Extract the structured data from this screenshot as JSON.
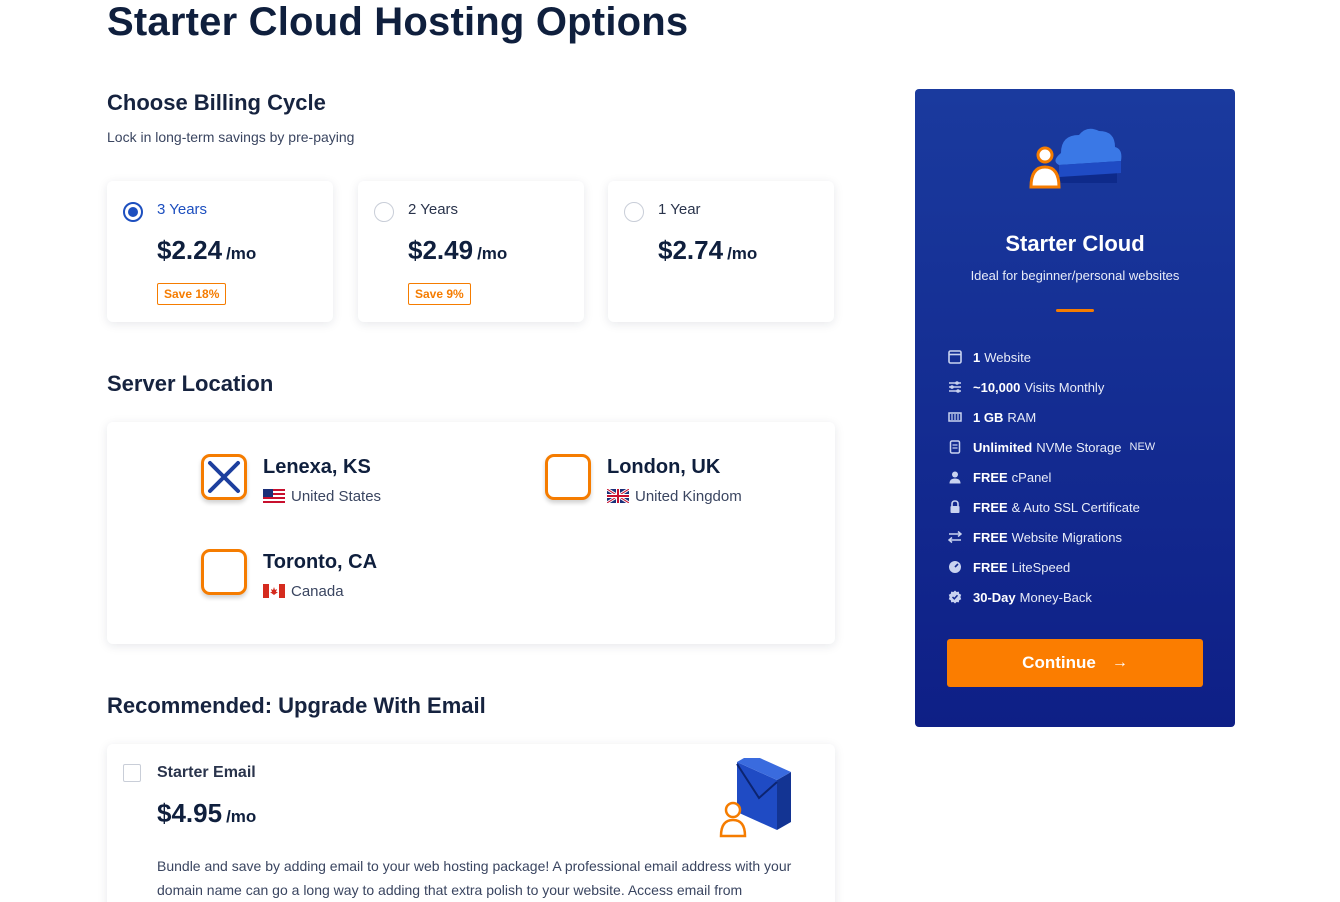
{
  "page": {
    "title": "Starter Cloud Hosting Options"
  },
  "billing": {
    "title": "Choose Billing Cycle",
    "subtitle": "Lock in long-term savings by pre-paying",
    "options": [
      {
        "term": "3 Years",
        "price": "$2.24",
        "per": "/mo",
        "save": "Save 18%",
        "selected": true
      },
      {
        "term": "2 Years",
        "price": "$2.49",
        "per": "/mo",
        "save": "Save 9%",
        "selected": false
      },
      {
        "term": "1 Year",
        "price": "$2.74",
        "per": "/mo",
        "save": "",
        "selected": false
      }
    ]
  },
  "location": {
    "title": "Server Location",
    "options": [
      {
        "city": "Lenexa, KS",
        "country": "United States",
        "selected": true
      },
      {
        "city": "London, UK",
        "country": "United Kingdom",
        "selected": false
      },
      {
        "city": "Toronto, CA",
        "country": "Canada",
        "selected": false
      }
    ]
  },
  "email": {
    "title": "Recommended: Upgrade With Email",
    "name": "Starter Email",
    "price": "$4.95",
    "per": "/mo",
    "description": "Bundle and save by adding email to your web hosting package! A professional email address with your domain name can go a long way to adding that extra polish to your website. Access email from"
  },
  "summary": {
    "plan": "Starter Cloud",
    "tagline": "Ideal for beginner/personal websites",
    "features": [
      {
        "icon": "window-icon",
        "bold": "1",
        "text": "Website",
        "badge": ""
      },
      {
        "icon": "sliders-icon",
        "bold": "~10,000",
        "text": "Visits Monthly",
        "badge": ""
      },
      {
        "icon": "memory-icon",
        "bold": "1 GB",
        "text": "RAM",
        "badge": ""
      },
      {
        "icon": "storage-icon",
        "bold": "Unlimited",
        "text": "NVMe Storage",
        "badge": "NEW"
      },
      {
        "icon": "user-icon",
        "bold": "FREE",
        "text": "cPanel",
        "badge": ""
      },
      {
        "icon": "lock-icon",
        "bold": "FREE",
        "text": "& Auto SSL Certificate",
        "badge": ""
      },
      {
        "icon": "transfer-icon",
        "bold": "FREE",
        "text": "Website Migrations",
        "badge": ""
      },
      {
        "icon": "speed-icon",
        "bold": "FREE",
        "text": "LiteSpeed",
        "badge": ""
      },
      {
        "icon": "badge-icon",
        "bold": "30-Day",
        "text": "Money-Back",
        "badge": ""
      }
    ],
    "cta": "Continue"
  },
  "colors": {
    "accent": "#f57c00",
    "brand": "#1d4fbf",
    "panel": "#12288f"
  }
}
